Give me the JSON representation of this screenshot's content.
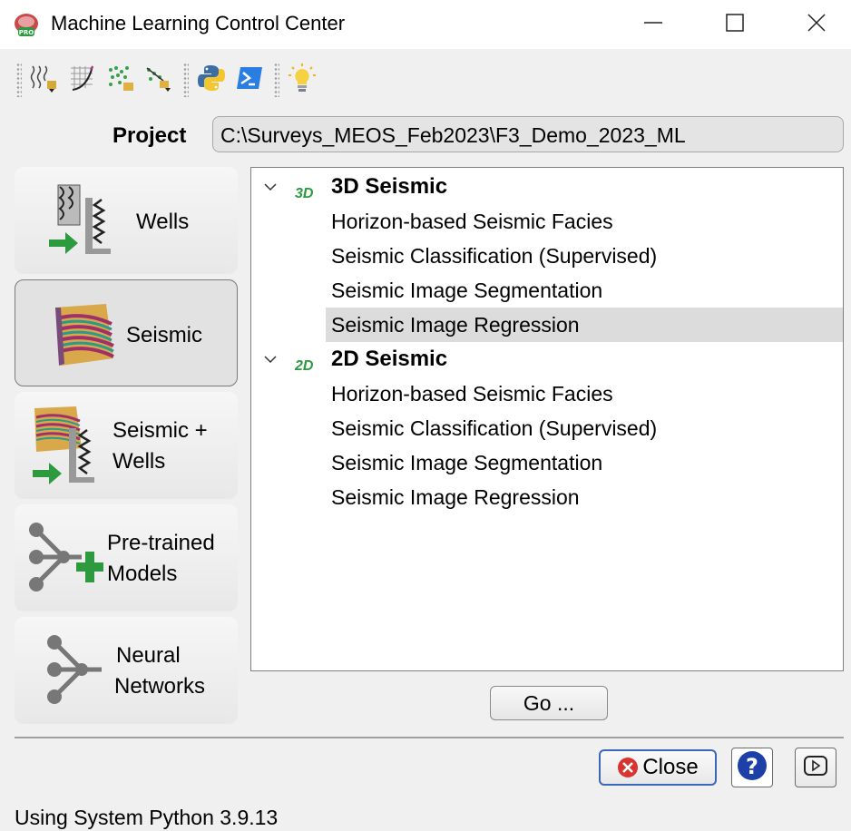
{
  "window": {
    "title": "Machine Learning Control Center",
    "controls": {
      "minimize": "minimize-icon",
      "maximize": "maximize-icon",
      "close": "close-icon"
    }
  },
  "toolbar": {
    "groups": [
      [
        "well-logs-import-icon",
        "crossplot-icon",
        "scatter-data-icon",
        "point-set-export-icon"
      ],
      [
        "python-icon",
        "powershell-terminal-icon"
      ],
      [
        "lightbulb-tip-icon"
      ]
    ]
  },
  "project": {
    "label": "Project",
    "path": "C:\\Surveys_MEOS_Feb2023\\F3_Demo_2023_ML"
  },
  "categories": [
    {
      "label": "Wells",
      "icon": "wells-icon",
      "selected": false
    },
    {
      "label": "Seismic",
      "icon": "seismic-icon",
      "selected": true
    },
    {
      "label_line1": "Seismic +",
      "label_line2": "Wells",
      "icon": "seismic-wells-icon",
      "selected": false
    },
    {
      "label_line1": "Pre-trained",
      "label_line2": "Models",
      "icon": "pretrained-models-icon",
      "selected": false
    },
    {
      "label_line1": "Neural",
      "label_line2": "Networks",
      "icon": "neural-network-icon",
      "selected": false
    }
  ],
  "tree": {
    "groups": [
      {
        "badge": "3D",
        "label": "3D Seismic",
        "expanded": true,
        "items": [
          "Horizon-based Seismic Facies",
          "Seismic Classification (Supervised)",
          "Seismic Image Segmentation",
          "Seismic Image Regression"
        ],
        "selected_index": 3
      },
      {
        "badge": "2D",
        "label": "2D Seismic",
        "expanded": true,
        "items": [
          "Horizon-based Seismic Facies",
          "Seismic Classification (Supervised)",
          "Seismic Image Segmentation",
          "Seismic Image Regression"
        ]
      }
    ]
  },
  "actions": {
    "go_label": "Go ...",
    "close_label": "Close",
    "help_icon": "help-icon",
    "video_icon": "play-video-icon"
  },
  "status": "Using System Python 3.9.13",
  "colors": {
    "selection": "#dcdcdc",
    "accent_green": "#2e9a40",
    "help_blue": "#1d3fa8",
    "close_red": "#d9322f"
  }
}
